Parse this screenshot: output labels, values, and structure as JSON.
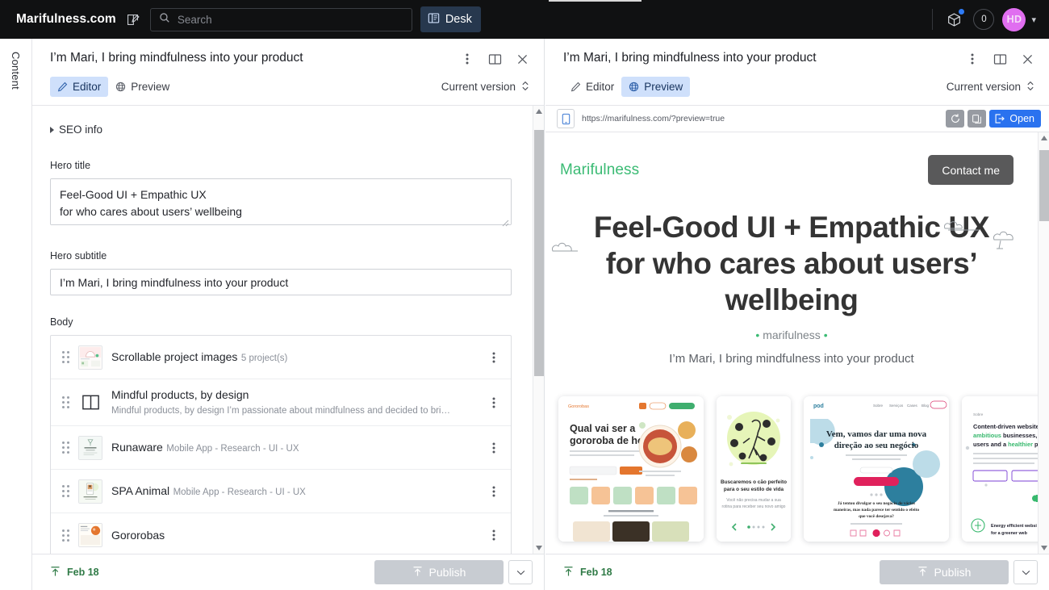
{
  "topbar": {
    "brand": "Marifulness.com",
    "compose_icon": "compose-icon",
    "search_placeholder": "Search",
    "search_value": "",
    "desk_label": "Desk",
    "packages_icon": "package-icon",
    "notification_count": "0",
    "avatar_initials": "HD"
  },
  "rail": {
    "label": "Content"
  },
  "editor_pane": {
    "title": "I’m Mari, I bring mindfulness into your product",
    "tabs": [
      {
        "label": "Editor",
        "icon": "pencil-icon",
        "active": true
      },
      {
        "label": "Preview",
        "icon": "globe-icon",
        "active": false
      }
    ],
    "version_label": "Current version",
    "seo_label": "SEO info",
    "fields": [
      {
        "label": "Hero title",
        "value": "Feel-Good UI + Empathic UX\nfor who cares about users’ wellbeing",
        "type": "textarea"
      },
      {
        "label": "Hero subtitle",
        "value": "I’m Mari, I bring mindfulness into your product",
        "type": "text"
      }
    ],
    "body_label": "Body",
    "body_items": [
      {
        "title": "Scrollable project images",
        "subtitle": "5 project(s)",
        "thumb": "thumb-scrollable-images"
      },
      {
        "title": "Mindful products, by design",
        "subtitle": "Mindful products, by design I’m passionate about mindfulness and decided to bri…",
        "thumb": "thumb-two-column-block"
      },
      {
        "title": "Runaware",
        "subtitle": "Mobile App - Research - UI - UX",
        "thumb": "thumb-runaware"
      },
      {
        "title": "SPA Animal",
        "subtitle": "Mobile App - Research - UI - UX",
        "thumb": "thumb-spa-animal"
      },
      {
        "title": "Gororobas",
        "subtitle": "",
        "thumb": "thumb-gororobas"
      }
    ],
    "footer": {
      "date": "Feb 18",
      "publish_label": "Publish"
    }
  },
  "preview_pane": {
    "title": "I’m Mari, I bring mindfulness into your product",
    "tabs": [
      {
        "label": "Editor",
        "icon": "pencil-icon",
        "active": false
      },
      {
        "label": "Preview",
        "icon": "globe-icon",
        "active": true
      }
    ],
    "version_label": "Current version",
    "url": "https://marifulness.com/?preview=true",
    "open_label": "Open",
    "device_icon": "mobile-icon",
    "reload_icon": "reload-icon",
    "copy_icon": "copy-icon",
    "site": {
      "logo": "Marifulness",
      "cta": "Contact me",
      "headline_line1": "Feel-Good UI + Empathic UX",
      "headline_line2": "for who cares about users’ wellbeing",
      "tagline_prefix": "•",
      "tagline": "marifulness",
      "tagline_suffix": "•",
      "subtitle": "I’m Mari, I bring mindfulness into your product",
      "cards": [
        {
          "name": "gororobas-site-card",
          "heading": "Qual vai ser a gororoba de hoje?"
        },
        {
          "name": "spa-animal-card",
          "heading": "Buscaremos o cão perfeito para o seu estilo de vida"
        },
        {
          "name": "pod-site-card",
          "heading": "Vem, vamos dar uma nova direção ao seu negócio"
        },
        {
          "name": "content-driven-card",
          "heading": "Content-driven websites for ambitious businesses, happy users and a healthier planet"
        }
      ]
    },
    "footer": {
      "date": "Feb 18",
      "publish_label": "Publish"
    }
  },
  "colors": {
    "topbar_bg": "#101112",
    "desk_bg": "#27384e",
    "accent_blue": "#2a72ef",
    "tab_active_bg": "#cfe0fb",
    "brand_green": "#3bbb74",
    "date_green": "#2f7a46",
    "avatar_bg": "#e06ef0",
    "publish_disabled": "#c8ccd2"
  }
}
